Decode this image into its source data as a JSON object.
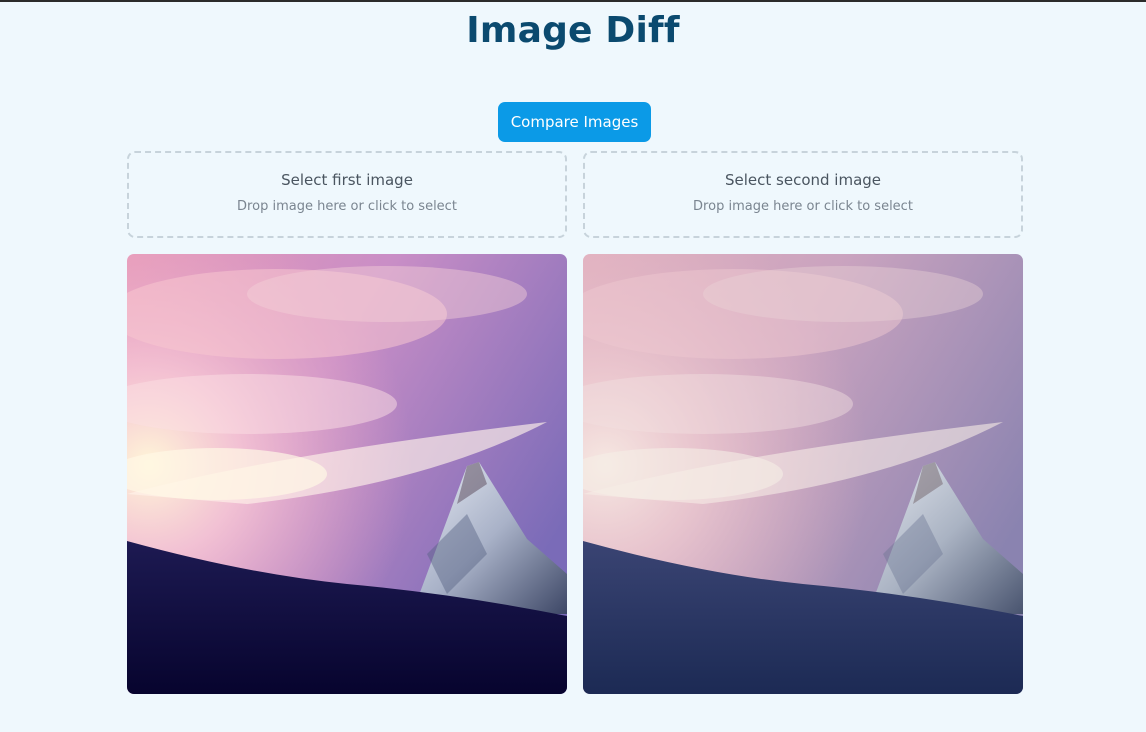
{
  "page": {
    "title": "Image Diff"
  },
  "toolbar": {
    "compare_label": "Compare Images"
  },
  "drop_zones": [
    {
      "label": "Select first image",
      "hint": "Drop image here or click to select"
    },
    {
      "label": "Select second image",
      "hint": "Drop image here or click to select"
    }
  ],
  "colors": {
    "background": "#eff8fd",
    "title": "#0b4a6f",
    "accent": "#0b9ae7"
  }
}
